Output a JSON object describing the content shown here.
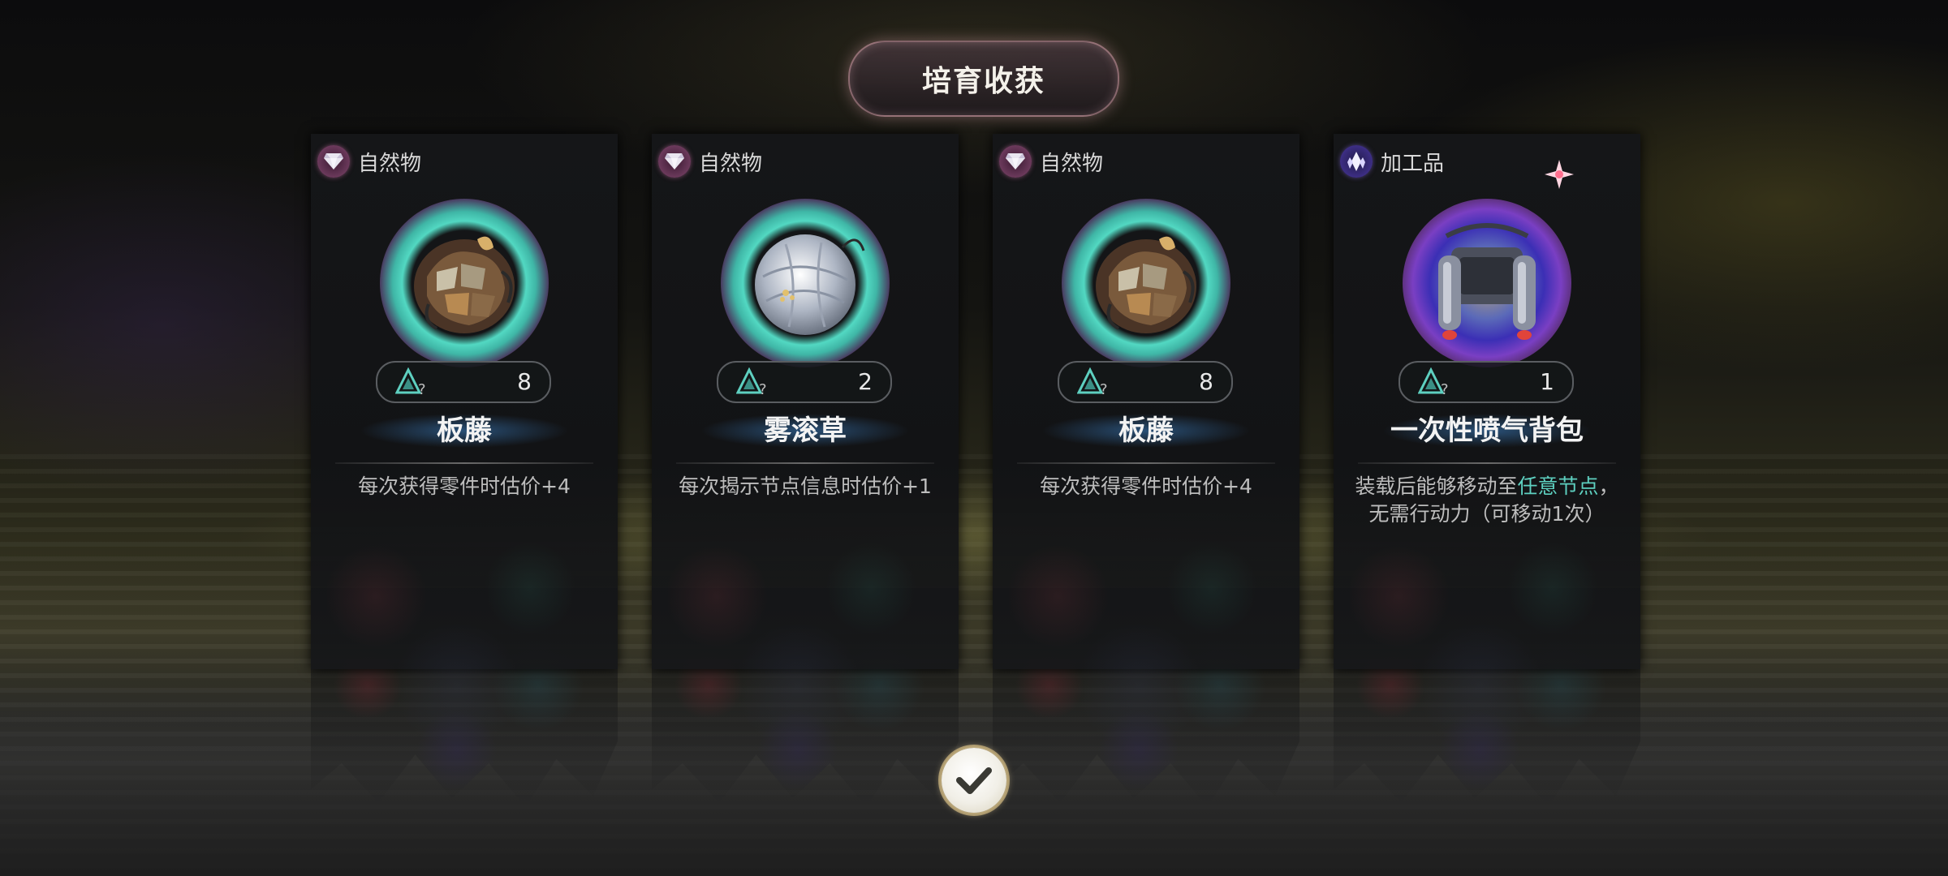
{
  "title": "培育收获",
  "cards": [
    {
      "category": "自然物",
      "category_icon": "gem-icon",
      "item": "板藤",
      "orb": "teal",
      "quantity": "8",
      "description": "每次获得零件时估价+4"
    },
    {
      "category": "自然物",
      "category_icon": "gem-icon",
      "item": "雾滚草",
      "orb": "teal",
      "quantity": "2",
      "description": "每次揭示节点信息时估价+1"
    },
    {
      "category": "自然物",
      "category_icon": "gem-icon",
      "item": "板藤",
      "orb": "teal",
      "quantity": "8",
      "description": "每次获得零件时估价+4"
    },
    {
      "category": "加工品",
      "category_icon": "crystal-shard-icon",
      "item": "一次性喷气背包",
      "orb": "violet",
      "quantity": "1",
      "description_prefix": "装载后能够移动至",
      "description_highlight": "任意节点",
      "description_suffix": "，无需行动力（可移动1次）"
    }
  ],
  "confirm_icon": "check-icon",
  "colors": {
    "highlight": "#5ed0c0",
    "orb_teal": "#52d8c2",
    "orb_violet": "#3b2fb5"
  }
}
